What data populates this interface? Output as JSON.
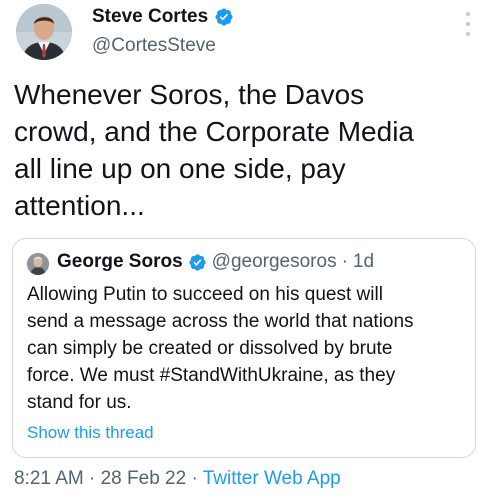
{
  "author": {
    "name": "Steve Cortes",
    "handle": "@CortesSteve",
    "avatar_icon": "profile-photo-avatar",
    "verified_icon": "verified-badge-icon"
  },
  "tweet": {
    "text": "Whenever Soros, the Davos\ncrowd, and the Corporate Media\nall line up on one side, pay\nattention..."
  },
  "quote": {
    "name": "George Soros",
    "handle": "@georgesoros",
    "separator": "·",
    "time": "1d",
    "text": "Allowing Putin to succeed on his quest will\nsend a message across the world that nations\ncan simply be created or dissolved by brute\nforce. We must #StandWithUkraine, as they\nstand for us.",
    "show_thread": "Show this thread"
  },
  "meta": {
    "time": "8:21 AM",
    "separator1": " · ",
    "date": "28 Feb 22",
    "separator2": " · ",
    "source": "Twitter Web App"
  },
  "colors": {
    "accent": "#1d9bf0",
    "text": "#0f1419",
    "muted": "#536471",
    "border": "#cfd9de"
  }
}
